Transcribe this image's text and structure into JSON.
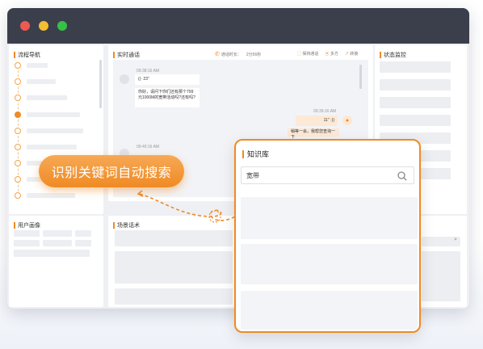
{
  "panels": {
    "nav_title": "流程导航",
    "call_title": "实时通话",
    "monitor_title": "状态监控",
    "profile_title": "用户画像",
    "script_title": "场景话术"
  },
  "call": {
    "duration_label": "通话时长：",
    "duration_value": "2分56秒",
    "actions": [
      "保持通话",
      "多方",
      "转接"
    ],
    "messages": [
      {
        "time": "09:38:16 AM",
        "voice": "23\"",
        "text": "你好，请问下你们还有那个799元1000M的宽带活动吗?还有吗?",
        "side": "left"
      },
      {
        "time": "09:39:16 AM",
        "voice": "11\"",
        "text": "稍等一会，我帮您查询一下",
        "side": "right"
      },
      {
        "time": "09:40:16 AM",
        "side": "left"
      }
    ],
    "keyword": "宽带"
  },
  "callout": "识别关键词自动搜索",
  "knowledge": {
    "title": "知识库",
    "search_value": "宽带"
  },
  "colors": {
    "accent": "#f08a24",
    "titlebar": "#3b3f4b"
  }
}
